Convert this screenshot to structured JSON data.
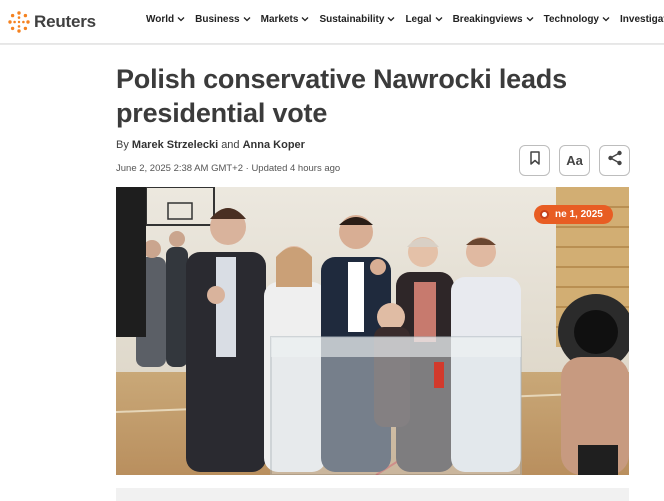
{
  "brand": {
    "name": "Reuters",
    "accent": "#f58220"
  },
  "nav": [
    {
      "label": "World",
      "has_menu": true
    },
    {
      "label": "Business",
      "has_menu": true
    },
    {
      "label": "Markets",
      "has_menu": true
    },
    {
      "label": "Sustainability",
      "has_menu": true
    },
    {
      "label": "Legal",
      "has_menu": true
    },
    {
      "label": "Breakingviews",
      "has_menu": true
    },
    {
      "label": "Technology",
      "has_menu": true
    },
    {
      "label": "Investigations",
      "has_menu": false
    }
  ],
  "article": {
    "headline": "Polish conservative Nawrocki leads presidential vote",
    "by": "By",
    "author1": "Marek Strzelecki",
    "and": "and",
    "author2": "Anna Koper",
    "dateline": "June 2, 2025 2:38 AM GMT+2 · Updated 4 hours ago"
  },
  "tools": {
    "bookmark_icon": "bookmark-icon",
    "text_size_label": "Aa",
    "share_icon": "share-icon"
  },
  "photo": {
    "badge_text": "ne 1, 2025",
    "badge_color": "#e85d23"
  }
}
